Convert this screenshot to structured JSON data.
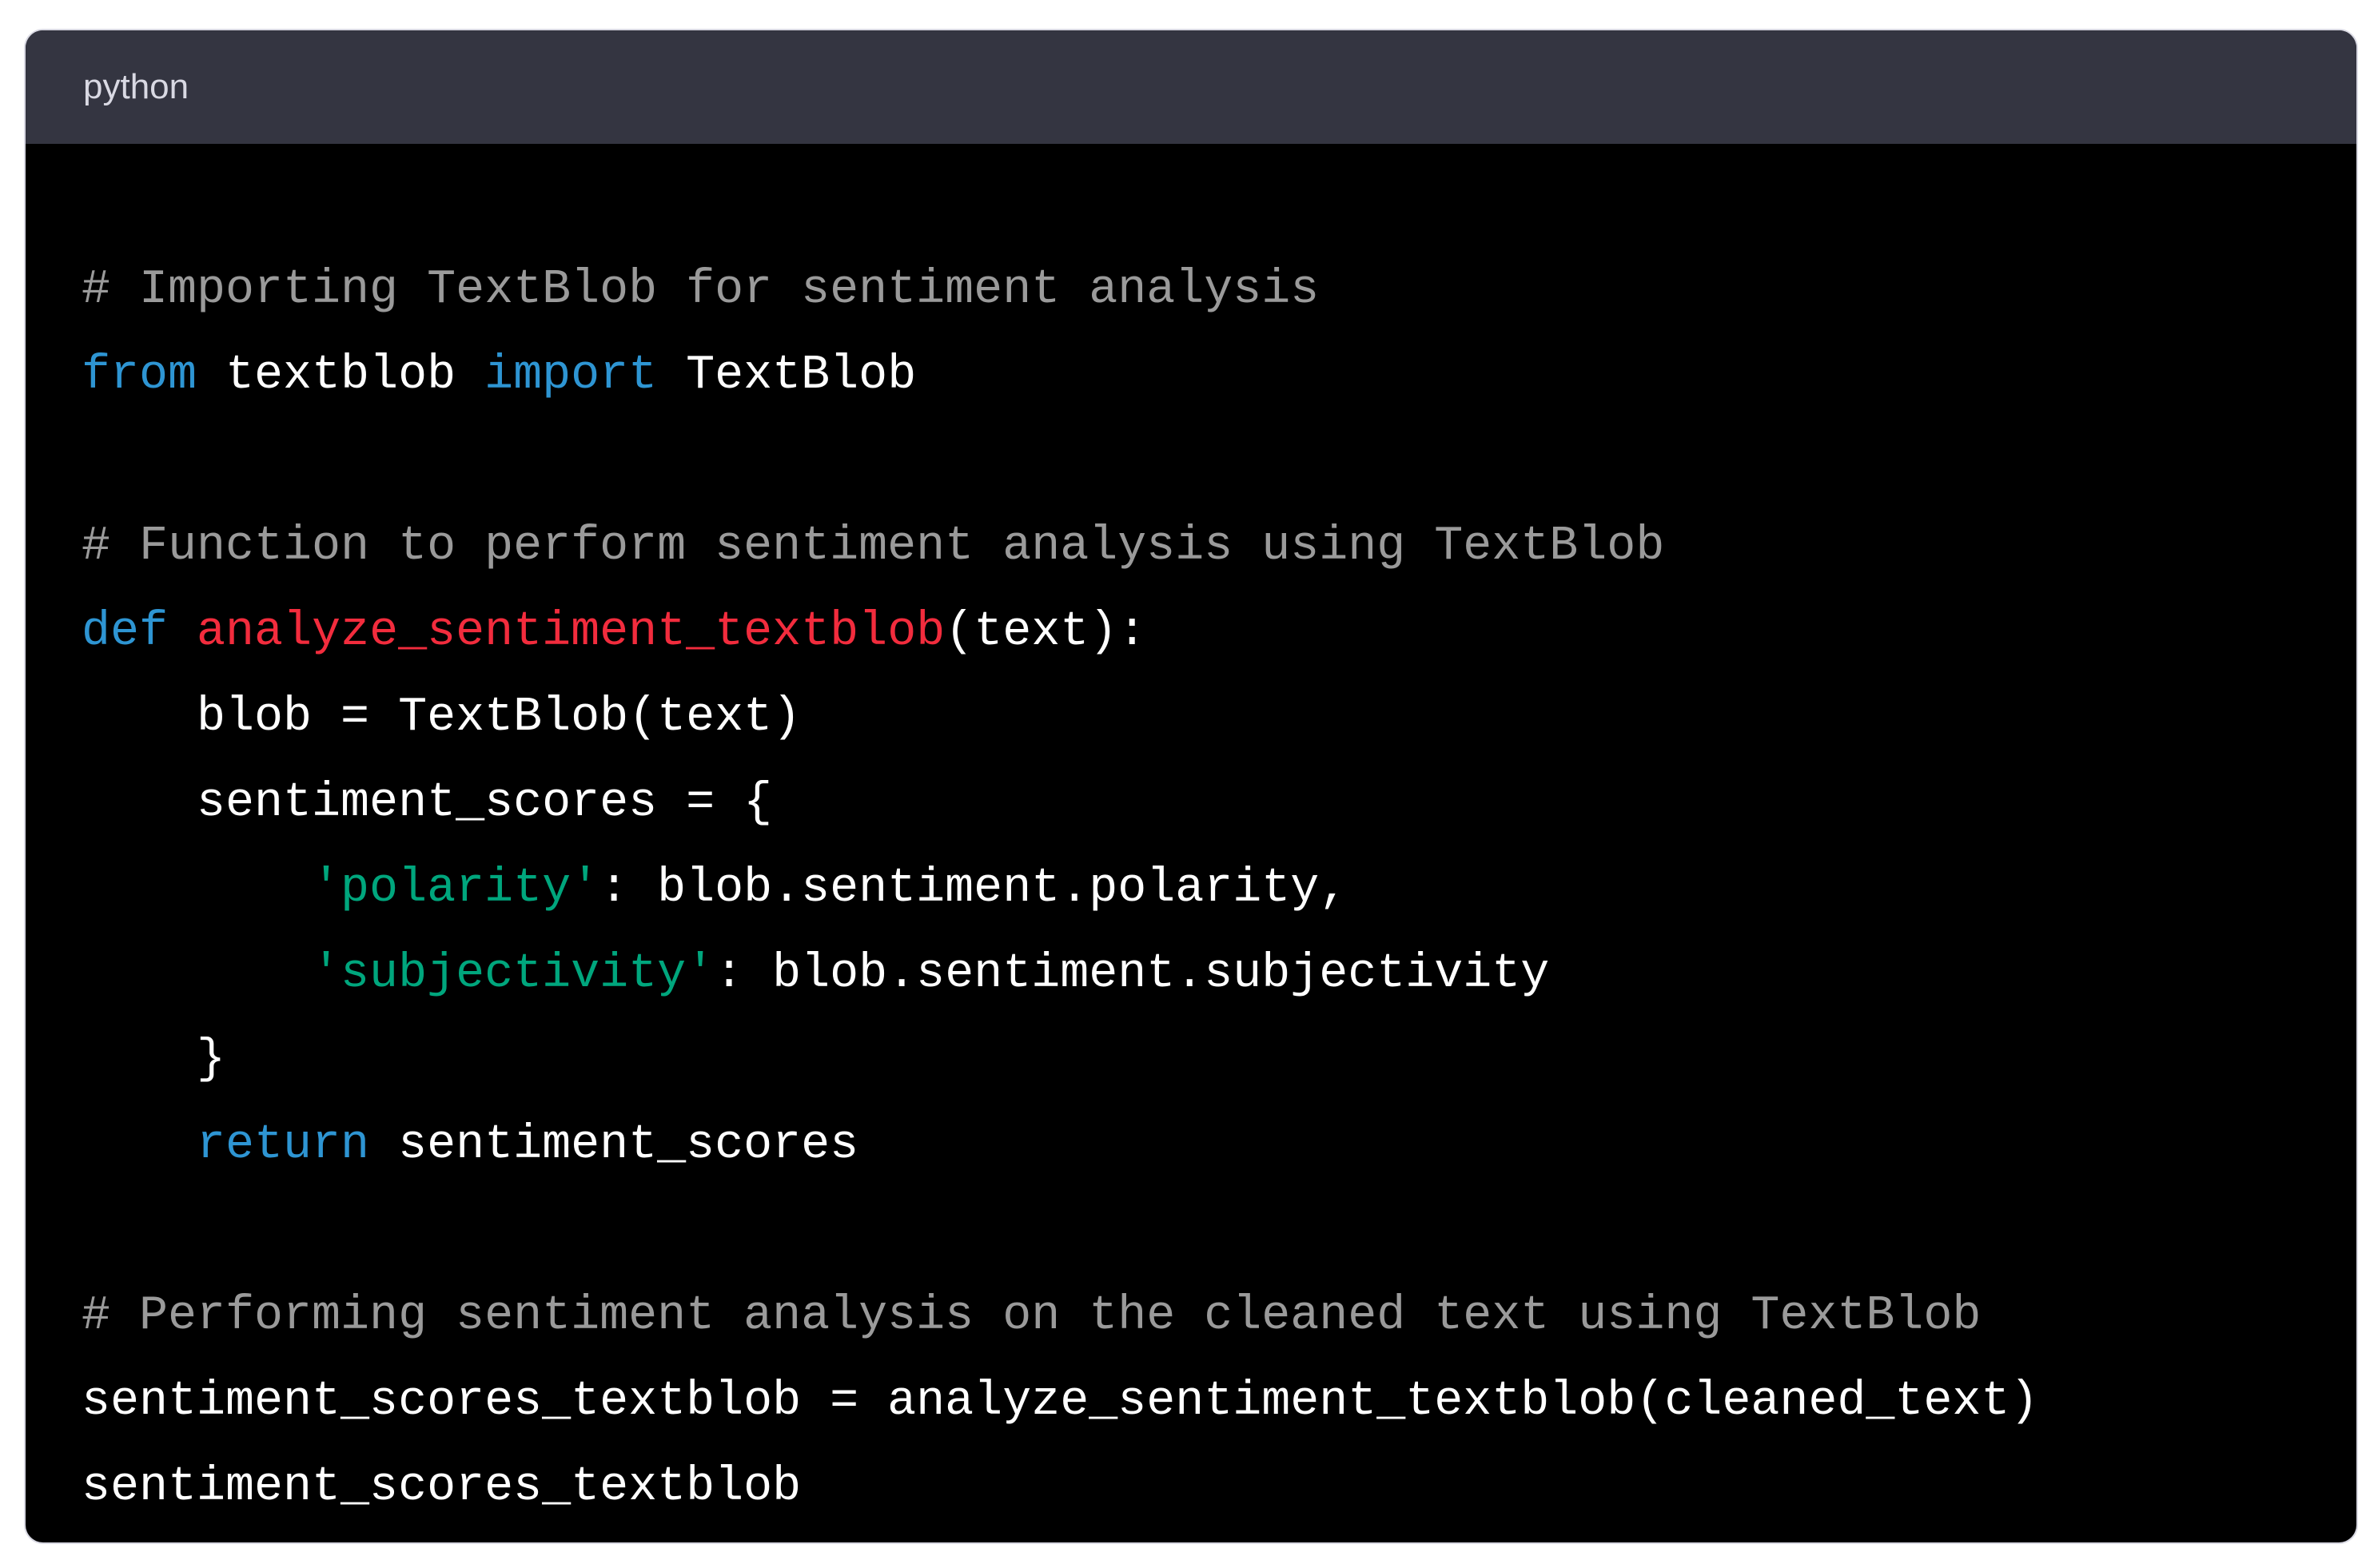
{
  "code_block": {
    "language": "python",
    "colors": {
      "header_bg": "#343541",
      "body_bg": "#000000",
      "comment": "#9a9a9a",
      "keyword": "#2e95d3",
      "function_name": "#f22c3d",
      "string": "#00a67d",
      "plain": "#ffffff"
    },
    "lines": [
      [
        {
          "t": "comment",
          "v": "# Importing TextBlob for sentiment analysis"
        }
      ],
      [
        {
          "t": "keyword",
          "v": "from"
        },
        {
          "t": "plain",
          "v": " textblob "
        },
        {
          "t": "keyword",
          "v": "import"
        },
        {
          "t": "plain",
          "v": " TextBlob"
        }
      ],
      [],
      [
        {
          "t": "comment",
          "v": "# Function to perform sentiment analysis using TextBlob"
        }
      ],
      [
        {
          "t": "keyword",
          "v": "def"
        },
        {
          "t": "plain",
          "v": " "
        },
        {
          "t": "func",
          "v": "analyze_sentiment_textblob"
        },
        {
          "t": "plain",
          "v": "(text):"
        }
      ],
      [
        {
          "t": "plain",
          "v": "    blob = TextBlob(text)"
        }
      ],
      [
        {
          "t": "plain",
          "v": "    sentiment_scores = {"
        }
      ],
      [
        {
          "t": "plain",
          "v": "        "
        },
        {
          "t": "string",
          "v": "'polarity'"
        },
        {
          "t": "plain",
          "v": ": blob.sentiment.polarity,"
        }
      ],
      [
        {
          "t": "plain",
          "v": "        "
        },
        {
          "t": "string",
          "v": "'subjectivity'"
        },
        {
          "t": "plain",
          "v": ": blob.sentiment.subjectivity"
        }
      ],
      [
        {
          "t": "plain",
          "v": "    }"
        }
      ],
      [
        {
          "t": "plain",
          "v": "    "
        },
        {
          "t": "keyword",
          "v": "return"
        },
        {
          "t": "plain",
          "v": " sentiment_scores"
        }
      ],
      [],
      [
        {
          "t": "comment",
          "v": "# Performing sentiment analysis on the cleaned text using TextBlob"
        }
      ],
      [
        {
          "t": "plain",
          "v": "sentiment_scores_textblob = analyze_sentiment_textblob(cleaned_text)"
        }
      ],
      [
        {
          "t": "plain",
          "v": "sentiment_scores_textblob"
        }
      ]
    ]
  }
}
